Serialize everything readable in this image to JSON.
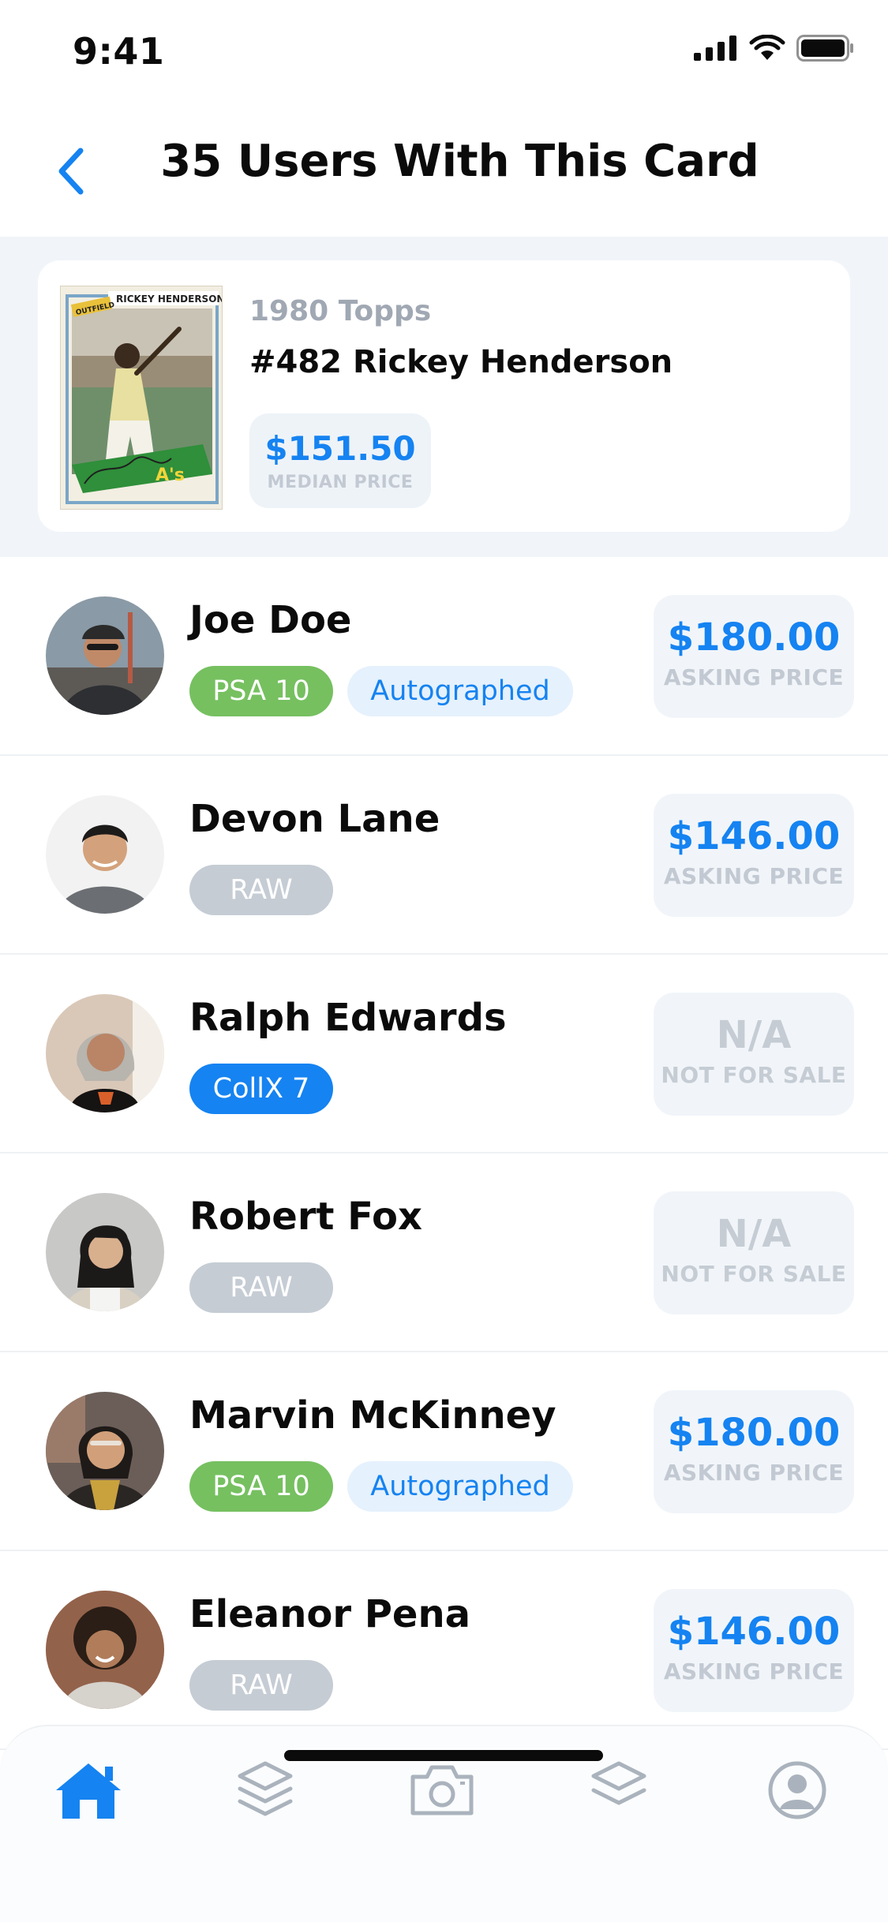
{
  "status": {
    "time": "9:41"
  },
  "header": {
    "title": "35 Users With This Card"
  },
  "card": {
    "set": "1980 Topps",
    "name": "#482 Rickey Henderson",
    "median_price": "$151.50",
    "median_label": "MEDIAN PRICE",
    "thumb_top_text": "RICKEY HENDERSON",
    "thumb_corner_text": "OUTFIELD",
    "thumb_team_text": "A's"
  },
  "users": [
    {
      "name": "Joe Doe",
      "tags": [
        {
          "label": "PSA 10",
          "style": "green"
        },
        {
          "label": "Autographed",
          "style": "lightblue"
        }
      ],
      "price": "$180.00",
      "price_label": "ASKING PRICE",
      "for_sale": true
    },
    {
      "name": "Devon Lane",
      "tags": [
        {
          "label": "RAW",
          "style": "gray"
        }
      ],
      "price": "$146.00",
      "price_label": "ASKING PRICE",
      "for_sale": true
    },
    {
      "name": "Ralph Edwards",
      "tags": [
        {
          "label": "CollX 7",
          "style": "blue"
        }
      ],
      "price": "N/A",
      "price_label": "NOT FOR SALE",
      "for_sale": false
    },
    {
      "name": "Robert Fox",
      "tags": [
        {
          "label": "RAW",
          "style": "gray"
        }
      ],
      "price": "N/A",
      "price_label": "NOT FOR SALE",
      "for_sale": false
    },
    {
      "name": "Marvin McKinney",
      "tags": [
        {
          "label": "PSA 10",
          "style": "green"
        },
        {
          "label": "Autographed",
          "style": "lightblue"
        }
      ],
      "price": "$180.00",
      "price_label": "ASKING PRICE",
      "for_sale": true
    },
    {
      "name": "Eleanor Pena",
      "tags": [
        {
          "label": "RAW",
          "style": "gray"
        }
      ],
      "price": "$146.00",
      "price_label": "ASKING PRICE",
      "for_sale": true
    }
  ],
  "tabbar": {
    "items": [
      {
        "icon": "home-icon",
        "active": true
      },
      {
        "icon": "layers-icon",
        "active": false
      },
      {
        "icon": "camera-icon",
        "active": false
      },
      {
        "icon": "stack-icon",
        "active": false
      },
      {
        "icon": "profile-icon",
        "active": false
      }
    ]
  },
  "colors": {
    "accent": "#1583f1",
    "green": "#76c060",
    "muted": "#c5ccd4",
    "panel": "#f1f5f9"
  }
}
